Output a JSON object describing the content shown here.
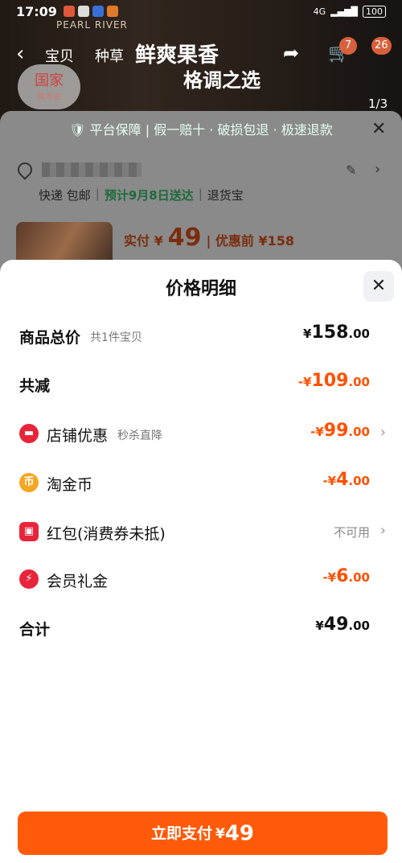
{
  "status": {
    "time": "17:09",
    "network": "4G",
    "battery": "100"
  },
  "background": {
    "brand": "PEARL RIVER",
    "nav_tabs": [
      "宝贝",
      "种草"
    ],
    "promo_line1": "鲜爽果香",
    "promo_line2": "格调之选",
    "badges": [
      "7",
      "26"
    ],
    "page_indicator": "1/3",
    "guojia_badge": "国家",
    "guojia_sub": "青年安",
    "guarantee_text": "平台保障 | 假一赔十 · 破损包退 · 极速退款",
    "shipping": {
      "method": "快递 包邮",
      "estimate": "预计9月8日送达",
      "extra": "退货宝"
    },
    "price": {
      "pay_label": "实付 ¥",
      "pay_amount": "49",
      "pre_label": "| 优惠前 ¥158"
    }
  },
  "sheet": {
    "title": "价格明细",
    "rows": {
      "total": {
        "label": "商品总价",
        "sub": "共1件宝贝",
        "currency": "¥",
        "int": "158",
        "dec": ".00"
      },
      "reduce": {
        "label": "共减",
        "currency": "-¥",
        "int": "109",
        "dec": ".00"
      },
      "shop": {
        "label": "店铺优惠",
        "sub": "秒杀直降",
        "currency": "-¥",
        "int": "99",
        "dec": ".00"
      },
      "coin": {
        "label": "淘金币",
        "currency": "-¥",
        "int": "4",
        "dec": ".00"
      },
      "redpacket": {
        "label": "红包(消费券未抵)",
        "status": "不可用"
      },
      "member": {
        "label": "会员礼金",
        "currency": "-¥",
        "int": "6",
        "dec": ".00"
      },
      "sum": {
        "label": "合计",
        "currency": "¥",
        "int": "49",
        "dec": ".00"
      }
    },
    "pay_button": {
      "label": "立即支付",
      "currency": "¥",
      "amount": "49"
    }
  },
  "colors": {
    "accent": "#ff5000",
    "button": "#ff5a0a",
    "shop_icon": "#e8243a",
    "coin_icon": "#f5a623",
    "redpacket_icon": "#e8243a",
    "member_icon": "#e8243a"
  },
  "icons": {
    "shop": "shop-icon",
    "coin": "coin-icon",
    "redpacket": "redpacket-icon",
    "member": "lightning-icon"
  }
}
